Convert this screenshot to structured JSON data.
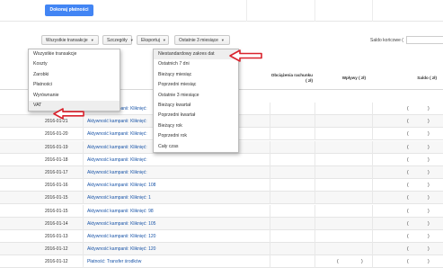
{
  "toolbar": {
    "pay_button": "Dokonaj płatności"
  },
  "filters": {
    "transactions": "Wszystkie transakcje",
    "details": "Szczegóły",
    "export": "Eksportuj",
    "period": "Ostatnie 3 miesiące"
  },
  "balance": {
    "label": "Saldo końcowe ("
  },
  "table": {
    "headers": {
      "charges": "Obciążenia rachunku ( zł)",
      "payments": "Wpływy ( zł)",
      "balance": "Saldo ( zł)"
    },
    "rows": [
      {
        "date": "2016-01-21",
        "desc": "Aktywność kampanii: Kliknięć: "
      },
      {
        "date": "2016-01-21",
        "desc": "Aktywność kampanii: Kliknięć: "
      },
      {
        "date": "2016-01-20",
        "desc": "Aktywność kampanii: Kliknięć: "
      },
      {
        "date": "2016-01-19",
        "desc": "Aktywność kampanii: Kliknięć: "
      },
      {
        "date": "2016-01-18",
        "desc": "Aktywność kampanii: Kliknięć: "
      },
      {
        "date": "2016-01-17",
        "desc": "Aktywność kampanii: Kliknięć: "
      },
      {
        "date": "2016-01-16",
        "desc": "Aktywność kampanii: Kliknięć: 108"
      },
      {
        "date": "2016-01-15",
        "desc": "Aktywność kampanii: Kliknięć: 1"
      },
      {
        "date": "2016-01-15",
        "desc": "Aktywność kampanii: Kliknięć: 98"
      },
      {
        "date": "2016-01-14",
        "desc": "Aktywność kampanii: Kliknięć: 105"
      },
      {
        "date": "2016-01-13",
        "desc": "Aktywność kampanii: Kliknięć: 120"
      },
      {
        "date": "2016-01-12",
        "desc": "Aktywność kampanii: Kliknięć: 120"
      },
      {
        "date": "2016-01-12",
        "desc": "Płatność: Transfer środków"
      }
    ],
    "amount_placeholder": "(",
    "amount_close": ")"
  },
  "transaction_menu": {
    "items": [
      "Wszystkie transakcje",
      "Koszty",
      "Zarobki",
      "Płatności",
      "Wyrównanie",
      "VAT"
    ]
  },
  "period_menu": {
    "items": [
      "Niestandardowy zakres dat",
      "Ostatnich 7 dni",
      "Bieżący miesiąc",
      "Poprzedni miesiąc",
      "Ostatnie 3 miesiące",
      "Bieżący kwartał",
      "Poprzedni kwartał",
      "Bieżący rok",
      "Poprzedni rok",
      "Cały czas"
    ]
  },
  "colors": {
    "accent": "#4285f4",
    "link": "#1a55a8",
    "arrow": "#d9232d"
  }
}
